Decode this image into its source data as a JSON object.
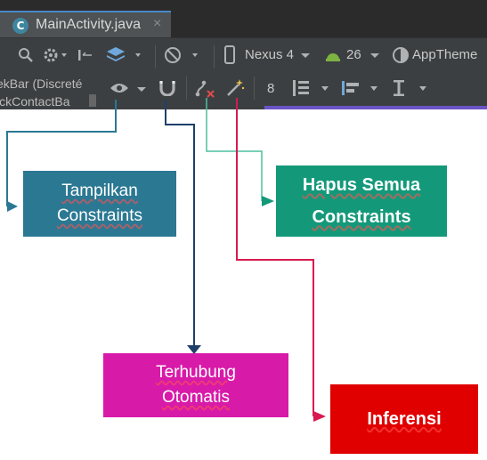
{
  "tab": {
    "title": "MainActivity.java",
    "logo_letter": "C",
    "close_glyph": "×"
  },
  "toolbar": {
    "device": "Nexus 4",
    "api": "26",
    "theme": "AppTheme",
    "margin_value": "8"
  },
  "palette": {
    "items": [
      "ekBar (Discreté",
      "ickContactBa"
    ]
  },
  "callouts": {
    "show_constraints": {
      "line1": "Tampilkan",
      "line2": "Constraints",
      "color": "#2b7893"
    },
    "clear_constraints": {
      "line1": "Hapus Semua",
      "line2": "Constraints",
      "color": "#13997a"
    },
    "autoconnect": {
      "line1": "Terhubung",
      "line2": "Otomatis",
      "color": "#d81aa9"
    },
    "infer": {
      "line1": "Inferensi",
      "color": "#e00000"
    }
  },
  "icons": [
    "search-icon",
    "settings-icon",
    "pan-icon",
    "layers-icon",
    "orientation-icon",
    "phone-icon",
    "android-icon",
    "theme-icon",
    "eye-icon",
    "magnet-icon",
    "clear-constraints-icon",
    "wand-icon",
    "align-vertical-icon",
    "align-left-icon",
    "guideline-icon"
  ]
}
